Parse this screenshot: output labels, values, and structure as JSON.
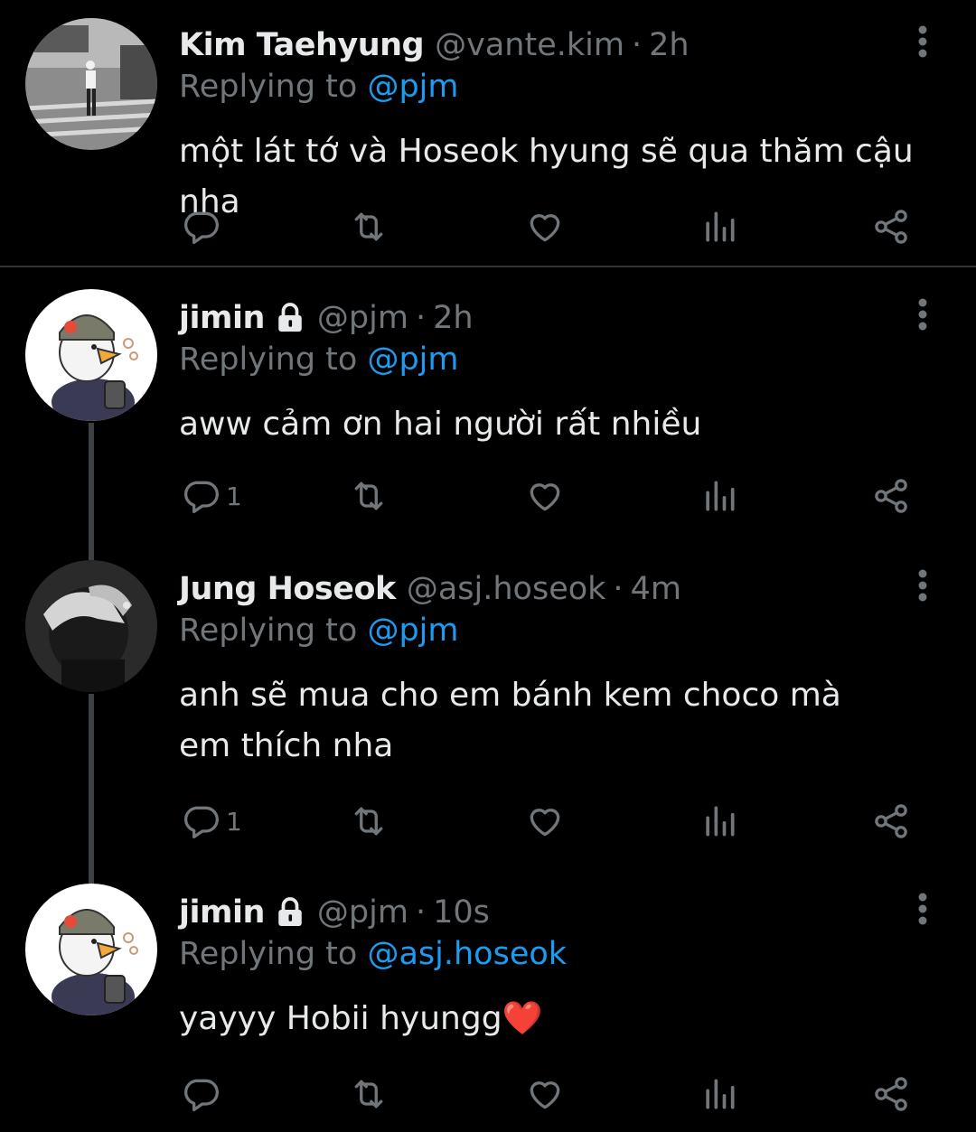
{
  "tweets": [
    {
      "name": "Kim Taehyung",
      "handle": "@vante.kim",
      "dot": "·",
      "time": "2h",
      "replying_prefix": "Replying to ",
      "replying_to": "@pjm",
      "text": "một lát tớ và Hoseok hyung sẽ qua thăm cậu nha",
      "reply_count": "",
      "locked": false
    },
    {
      "name": "jimin",
      "handle": "@pjm",
      "dot": "·",
      "time": "2h",
      "replying_prefix": "Replying to ",
      "replying_to": "@pjm",
      "text": "aww cảm ơn hai người rất nhiều",
      "reply_count": "1",
      "locked": true
    },
    {
      "name": "Jung Hoseok",
      "handle": "@asj.hoseok",
      "dot": "·",
      "time": "4m",
      "replying_prefix": "Replying to ",
      "replying_to": "@pjm",
      "text": "anh sẽ mua cho em bánh kem choco mà em thích nha",
      "reply_count": "1",
      "locked": false
    },
    {
      "name": "jimin",
      "handle": "@pjm",
      "dot": "·",
      "time": "10s",
      "replying_prefix": "Replying to ",
      "replying_to": "@asj.hoseok",
      "text": "yayyy Hobii hyungg❤️",
      "reply_count": "",
      "locked": true
    }
  ],
  "icons": {
    "reply": "reply-icon",
    "retweet": "retweet-icon",
    "like": "heart-icon",
    "views": "views-icon",
    "share": "share-icon",
    "more": "more-icon",
    "lock": "lock-icon"
  },
  "colors": {
    "background": "#000000",
    "text": "#e7e9ea",
    "muted": "#71767b",
    "accent": "#1d9bf0",
    "divider": "#2f3336"
  }
}
